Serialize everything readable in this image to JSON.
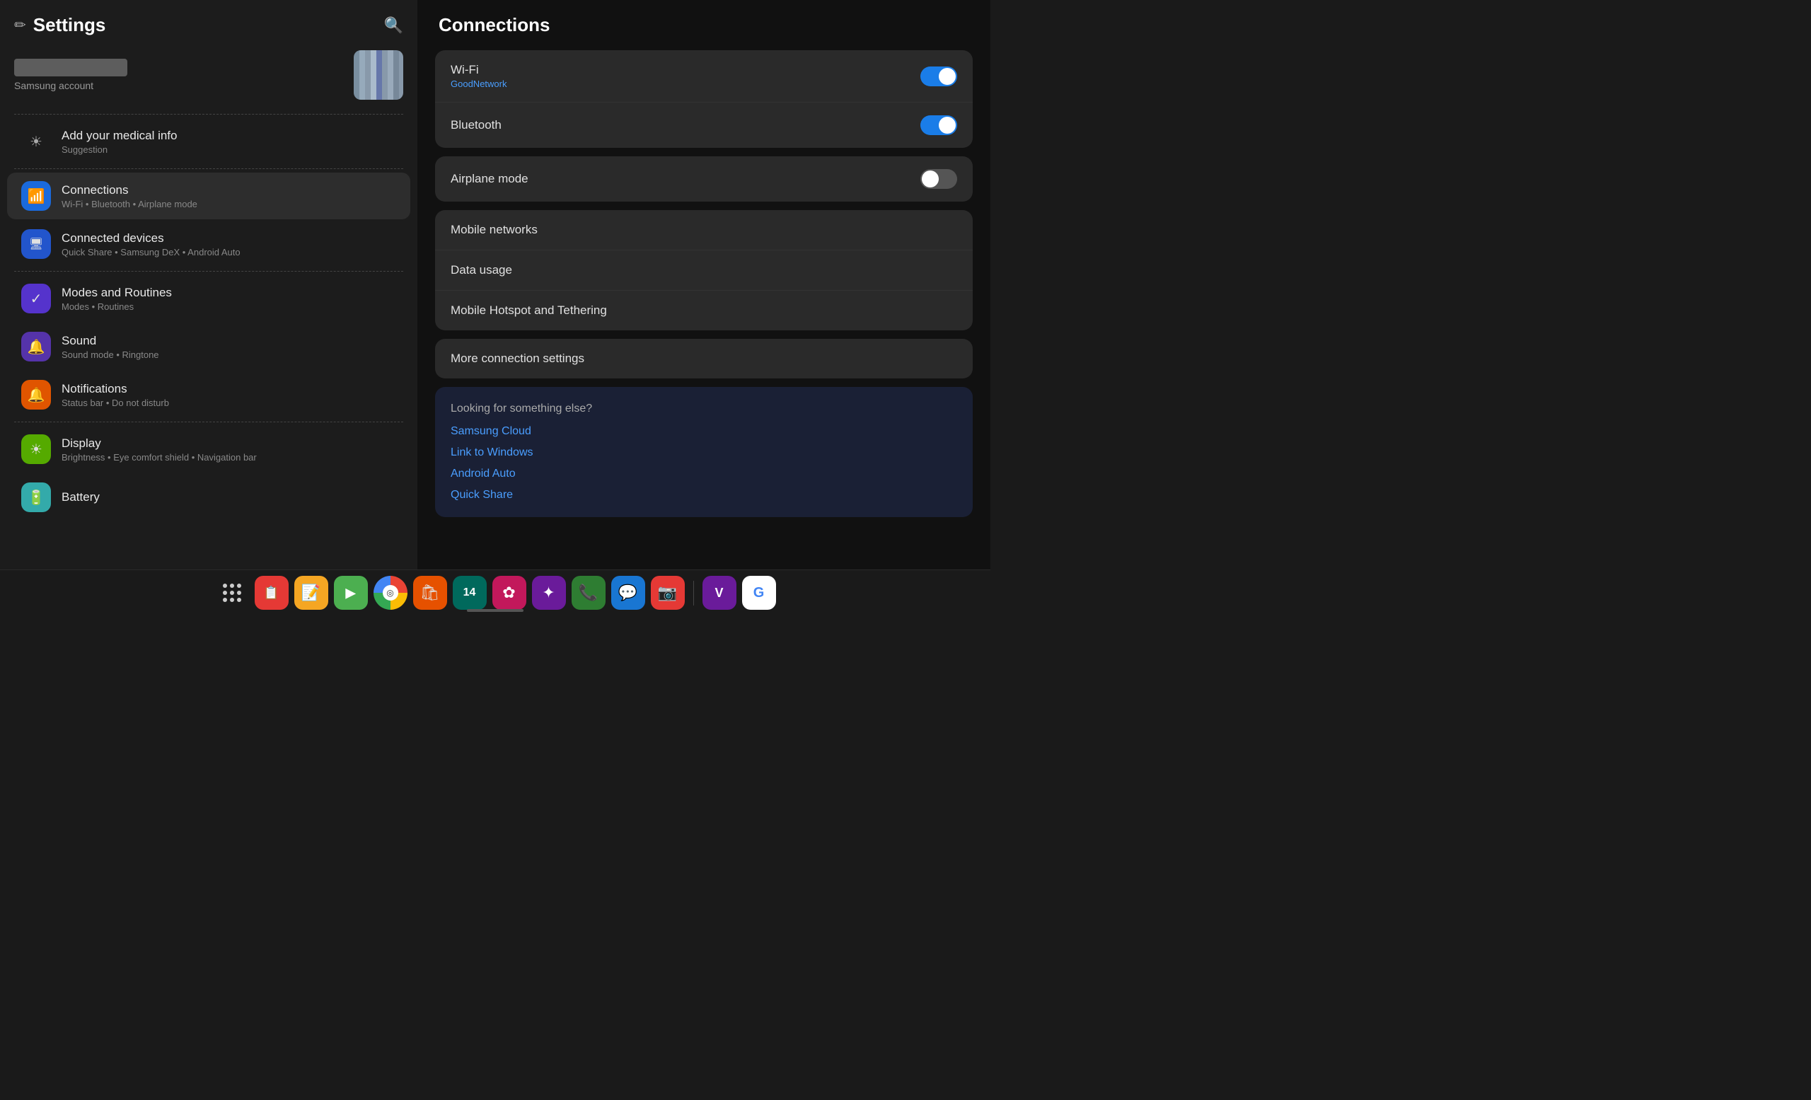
{
  "app": {
    "title": "Settings",
    "drag_handle": true
  },
  "header": {
    "title": "Settings",
    "search_icon": "🔍"
  },
  "account": {
    "label": "Samsung account",
    "has_avatar": true
  },
  "suggestion": {
    "title": "Add your medical info",
    "subtitle": "Suggestion"
  },
  "menu_items": [
    {
      "id": "connections",
      "title": "Connections",
      "subtitle": "Wi-Fi • Bluetooth • Airplane mode",
      "icon_color": "icon-wifi",
      "active": true
    },
    {
      "id": "connected_devices",
      "title": "Connected devices",
      "subtitle": "Quick Share • Samsung DeX • Android Auto",
      "icon_color": "icon-connected",
      "active": false
    },
    {
      "id": "modes_routines",
      "title": "Modes and Routines",
      "subtitle": "Modes • Routines",
      "icon_color": "icon-modes",
      "active": false
    },
    {
      "id": "sound",
      "title": "Sound",
      "subtitle": "Sound mode • Ringtone",
      "icon_color": "icon-sound",
      "active": false
    },
    {
      "id": "notifications",
      "title": "Notifications",
      "subtitle": "Status bar • Do not disturb",
      "icon_color": "icon-notifications",
      "active": false
    },
    {
      "id": "display",
      "title": "Display",
      "subtitle": "Brightness • Eye comfort shield • Navigation bar",
      "icon_color": "icon-display",
      "active": false
    },
    {
      "id": "battery",
      "title": "Battery",
      "subtitle": "",
      "icon_color": "icon-battery",
      "active": false,
      "partial": true
    }
  ],
  "connections_panel": {
    "title": "Connections",
    "toggles": [
      {
        "label": "Wi-Fi",
        "sublabel": "GoodNetwork",
        "state": "on"
      },
      {
        "label": "Bluetooth",
        "sublabel": "",
        "state": "on"
      }
    ],
    "toggle_airplane": {
      "label": "Airplane mode",
      "state": "off"
    },
    "simple_items": [
      {
        "label": "Mobile networks"
      },
      {
        "label": "Data usage"
      },
      {
        "label": "Mobile Hotspot and Tethering"
      }
    ],
    "more": {
      "label": "More connection settings"
    },
    "looking_for": {
      "title": "Looking for something else?",
      "links": [
        "Samsung Cloud",
        "Link to Windows",
        "Android Auto",
        "Quick Share"
      ]
    }
  },
  "taskbar": {
    "apps": [
      {
        "name": "app-drawer",
        "icon": "⋮⋮⋮",
        "color": "tb-dark"
      },
      {
        "name": "tasks-app",
        "icon": "📋",
        "color": "tb-red"
      },
      {
        "name": "notes-app",
        "icon": "📝",
        "color": "tb-yellow"
      },
      {
        "name": "play-store",
        "icon": "▶",
        "color": "tb-green"
      },
      {
        "name": "chrome-browser",
        "icon": "◎",
        "color": "tb-blue"
      },
      {
        "name": "shopping-app",
        "icon": "🛍",
        "color": "tb-orange"
      },
      {
        "name": "calendar-app",
        "icon": "14",
        "color": "tb-teal"
      },
      {
        "name": "flower-app",
        "icon": "✿",
        "color": "tb-pink"
      },
      {
        "name": "octo-app",
        "icon": "✦",
        "color": "tb-purple"
      },
      {
        "name": "phone-app",
        "icon": "📞",
        "color": "tb-green2"
      },
      {
        "name": "messages-app",
        "icon": "💬",
        "color": "tb-blue2"
      },
      {
        "name": "camera-app",
        "icon": "📷",
        "color": "tb-red"
      },
      {
        "name": "v-app",
        "icon": "V",
        "color": "tb-purple"
      },
      {
        "name": "google-app",
        "icon": "G",
        "color": "tb-blue"
      }
    ]
  }
}
